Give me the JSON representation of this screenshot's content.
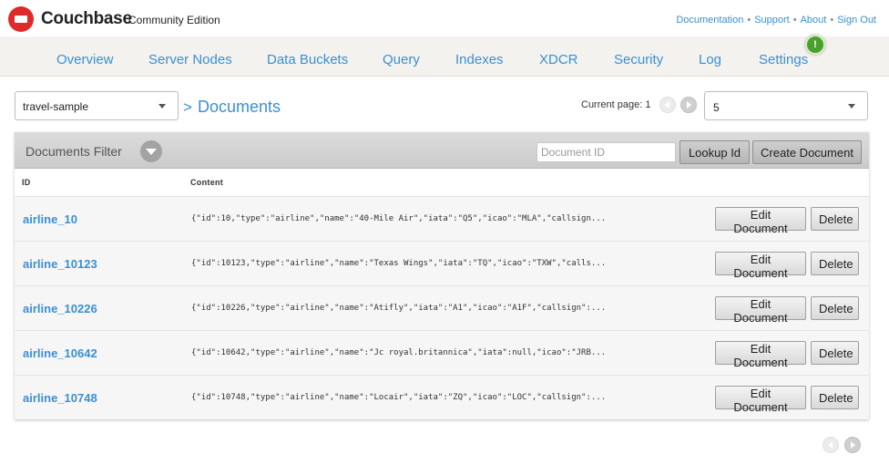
{
  "header": {
    "brand": "Couchbase",
    "edition": "Community Edition",
    "links": [
      "Documentation",
      "Support",
      "About",
      "Sign Out"
    ]
  },
  "nav": {
    "items": [
      "Overview",
      "Server Nodes",
      "Data Buckets",
      "Query",
      "Indexes",
      "XDCR",
      "Security",
      "Log",
      "Settings"
    ],
    "settings_badge": "!"
  },
  "controls": {
    "bucket": "travel-sample",
    "crumb_separator": ">",
    "page_title": "Documents",
    "current_page_label": "Current page: 1",
    "page_size": "5"
  },
  "filter": {
    "title": "Documents Filter",
    "doc_id_placeholder": "Document ID",
    "lookup_label": "Lookup Id",
    "create_label": "Create Document"
  },
  "table": {
    "columns": [
      "ID",
      "Content"
    ],
    "edit_label": "Edit Document",
    "delete_label": "Delete",
    "rows": [
      {
        "id": "airline_10",
        "content": "{\"id\":10,\"type\":\"airline\",\"name\":\"40-Mile Air\",\"iata\":\"Q5\",\"icao\":\"MLA\",\"callsign..."
      },
      {
        "id": "airline_10123",
        "content": "{\"id\":10123,\"type\":\"airline\",\"name\":\"Texas Wings\",\"iata\":\"TQ\",\"icao\":\"TXW\",\"calls..."
      },
      {
        "id": "airline_10226",
        "content": "{\"id\":10226,\"type\":\"airline\",\"name\":\"Atifly\",\"iata\":\"A1\",\"icao\":\"A1F\",\"callsign\":..."
      },
      {
        "id": "airline_10642",
        "content": "{\"id\":10642,\"type\":\"airline\",\"name\":\"Jc royal.britannica\",\"iata\":null,\"icao\":\"JRB..."
      },
      {
        "id": "airline_10748",
        "content": "{\"id\":10748,\"type\":\"airline\",\"name\":\"Locair\",\"iata\":\"ZQ\",\"icao\":\"LOC\",\"callsign\":..."
      }
    ]
  },
  "colors": {
    "accent": "#3a8fd4",
    "brand_red": "#e02929",
    "badge_green": "#4aa02c",
    "nav_bg": "#f4f2ee"
  },
  "icons": [
    "couchbase-logo-icon",
    "chevron-down-icon",
    "prev-page-icon",
    "next-page-icon",
    "filter-toggle-icon",
    "alert-badge-icon"
  ]
}
